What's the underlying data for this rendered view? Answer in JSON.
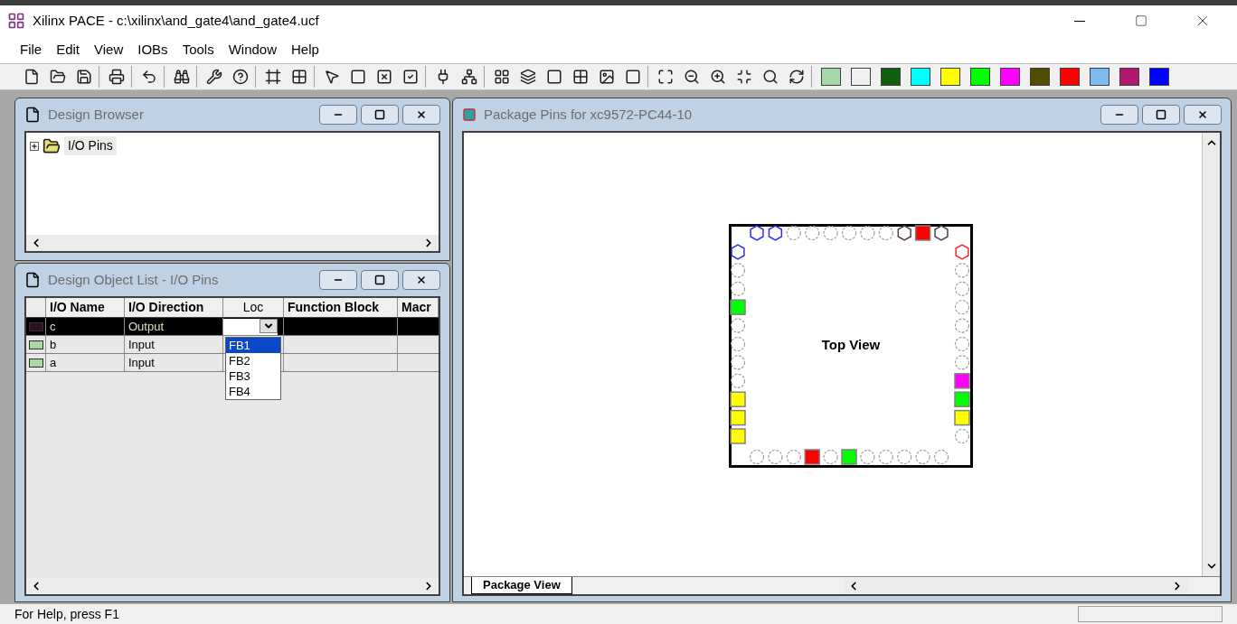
{
  "window": {
    "title": "Xilinx PACE - c:\\xilinx\\and_gate4\\and_gate4.ucf"
  },
  "menu": [
    "File",
    "Edit",
    "View",
    "IOBs",
    "Tools",
    "Window",
    "Help"
  ],
  "palette": [
    {
      "color": "#a8d8a8"
    },
    {
      "color": "#f0f0f0"
    },
    {
      "color": "#106010"
    },
    {
      "color": "#00ffff"
    },
    {
      "color": "#ffff00"
    },
    {
      "color": "#00ff00"
    },
    {
      "color": "#ff00ff"
    },
    {
      "color": "#504c00"
    },
    {
      "color": "#ff0000"
    },
    {
      "color": "#80b8f0"
    },
    {
      "color": "#b01870"
    },
    {
      "color": "#0000ff"
    }
  ],
  "design_browser": {
    "title": "Design Browser",
    "tree": [
      {
        "label": "I/O Pins",
        "expanded": false
      }
    ]
  },
  "object_list": {
    "title": "Design Object List - I/O Pins",
    "columns": [
      "I/O Name",
      "I/O Direction",
      "Loc",
      "Function Block",
      "Macr"
    ],
    "rows": [
      {
        "name": "c",
        "direction": "Output",
        "selected": true
      },
      {
        "name": "b",
        "direction": "Input",
        "selected": false
      },
      {
        "name": "a",
        "direction": "Input",
        "selected": false
      }
    ],
    "dropdown": [
      {
        "label": "FB1",
        "selected": true
      },
      {
        "label": "FB2",
        "selected": false
      },
      {
        "label": "FB3",
        "selected": false
      },
      {
        "label": "FB4",
        "selected": false
      }
    ]
  },
  "package": {
    "title": "Package Pins for xc9572-PC44-10",
    "label": "Top View",
    "tab": "Package View",
    "top": [
      {
        "kind": "hex",
        "color": "#3030f0"
      },
      {
        "kind": "hex",
        "color": "#3030f0"
      },
      {
        "kind": "circle",
        "color": "#a0a0a0"
      },
      {
        "kind": "circle",
        "color": "#a0a0a0"
      },
      {
        "kind": "circle",
        "color": "#a0a0a0"
      },
      {
        "kind": "circle",
        "color": "#a0a0a0"
      },
      {
        "kind": "circle",
        "color": "#a0a0a0"
      },
      {
        "kind": "circle",
        "color": "#a0a0a0"
      },
      {
        "kind": "hex",
        "color": "#504050"
      },
      {
        "kind": "square",
        "color": "#ff0000"
      },
      {
        "kind": "hex",
        "color": "#504050"
      }
    ],
    "left": [
      {
        "kind": "hex",
        "color": "#3030f0"
      },
      {
        "kind": "circle",
        "color": "#a0a0a0"
      },
      {
        "kind": "circle",
        "color": "#a0a0a0"
      },
      {
        "kind": "square",
        "color": "#00ff00"
      },
      {
        "kind": "circle",
        "color": "#a0a0a0"
      },
      {
        "kind": "circle",
        "color": "#a0a0a0"
      },
      {
        "kind": "circle",
        "color": "#a0a0a0"
      },
      {
        "kind": "circle",
        "color": "#a0a0a0"
      },
      {
        "kind": "square",
        "color": "#ffff00"
      },
      {
        "kind": "square",
        "color": "#ffff00"
      },
      {
        "kind": "square",
        "color": "#ffff00"
      }
    ],
    "right": [
      {
        "kind": "hex",
        "color": "#f03030"
      },
      {
        "kind": "circle",
        "color": "#a0a0a0"
      },
      {
        "kind": "circle",
        "color": "#a0a0a0"
      },
      {
        "kind": "circle",
        "color": "#a0a0a0"
      },
      {
        "kind": "circle",
        "color": "#a0a0a0"
      },
      {
        "kind": "circle",
        "color": "#a0a0a0"
      },
      {
        "kind": "circle",
        "color": "#a0a0a0"
      },
      {
        "kind": "square",
        "color": "#ff00ff"
      },
      {
        "kind": "square",
        "color": "#00ff00"
      },
      {
        "kind": "square",
        "color": "#ffff00"
      },
      {
        "kind": "circle",
        "color": "#a0a0a0"
      }
    ],
    "bottom": [
      {
        "kind": "circle",
        "color": "#a0a0a0"
      },
      {
        "kind": "circle",
        "color": "#a0a0a0"
      },
      {
        "kind": "circle",
        "color": "#a0a0a0"
      },
      {
        "kind": "square",
        "color": "#ff0000"
      },
      {
        "kind": "circle",
        "color": "#a0a0a0"
      },
      {
        "kind": "square",
        "color": "#00ff00"
      },
      {
        "kind": "circle",
        "color": "#a0a0a0"
      },
      {
        "kind": "circle",
        "color": "#a0a0a0"
      },
      {
        "kind": "circle",
        "color": "#a0a0a0"
      },
      {
        "kind": "circle",
        "color": "#a0a0a0"
      },
      {
        "kind": "circle",
        "color": "#a0a0a0"
      }
    ]
  },
  "status_bar": "For Help, press F1"
}
